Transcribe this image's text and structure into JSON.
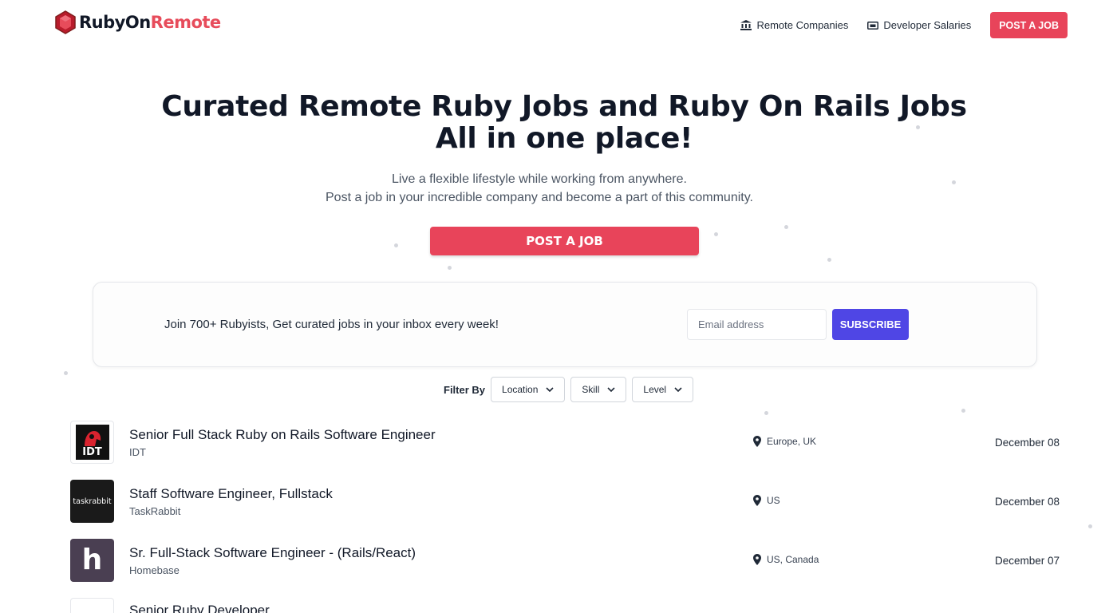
{
  "brand": {
    "name_part1": "RubyOn",
    "name_part2": "Remote",
    "accent": "#e8445a",
    "brand_red": "#e74c5b",
    "subscribe_color": "#4f46e5"
  },
  "nav": {
    "remote_companies": "Remote Companies",
    "developer_salaries": "Developer Salaries",
    "post_job": "POST A JOB"
  },
  "hero": {
    "title_line1": "Curated Remote Ruby Jobs and Ruby On Rails Jobs",
    "title_line2": "All in one place!",
    "subtitle_line1": "Live a flexible lifestyle while working from anywhere.",
    "subtitle_line2": "Post a job in your incredible company and become a part of this community.",
    "post_job": "POST A JOB"
  },
  "subscribe": {
    "text": "Join 700+ Rubyists, Get curated jobs in your inbox every week!",
    "email_placeholder": "Email address",
    "button": "SUBSCRIBE"
  },
  "filters": {
    "label": "Filter By",
    "options": [
      "Location",
      "Skill",
      "Level"
    ]
  },
  "jobs": [
    {
      "title": "Senior Full Stack Ruby on Rails Software Engineer",
      "company": "IDT",
      "location": "Europe, UK",
      "date": "December 08",
      "logo_text": "IDT",
      "logo_icon": "idt-logo-icon"
    },
    {
      "title": "Staff Software Engineer, Fullstack",
      "company": "TaskRabbit",
      "location": "US",
      "date": "December 08",
      "logo_text": "taskrabbit",
      "logo_icon": "taskrabbit-logo-icon"
    },
    {
      "title": "Sr. Full-Stack Software Engineer - (Rails/React)",
      "company": "Homebase",
      "location": "US, Canada",
      "date": "December 07",
      "logo_text": "h",
      "logo_icon": "homebase-logo-icon"
    },
    {
      "title": "Senior Ruby Developer",
      "company": "",
      "location": "",
      "date": "",
      "logo_text": "",
      "logo_icon": "company-logo-icon"
    }
  ]
}
